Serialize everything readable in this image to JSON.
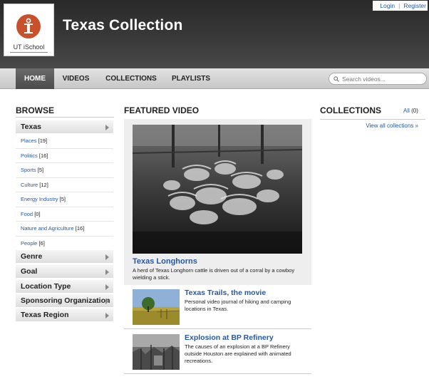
{
  "header": {
    "links": {
      "login": "Login",
      "separator": "|",
      "register": "Register"
    },
    "logo_text": "UT iSchool",
    "site_title": "Texas Collection"
  },
  "nav": {
    "items": [
      {
        "label": "HOME",
        "active": true
      },
      {
        "label": "VIDEOS"
      },
      {
        "label": "COLLECTIONS"
      },
      {
        "label": "PLAYLISTS"
      }
    ],
    "search_placeholder": "Search videos..."
  },
  "browse": {
    "heading": "BROWSE",
    "expanded_category": "Texas",
    "subitems": [
      {
        "label": "Places",
        "count": "[19]"
      },
      {
        "label": "Politics",
        "count": "[16]"
      },
      {
        "label": "Sports",
        "count": "[5]"
      },
      {
        "label": "Culture",
        "count": "[12]"
      },
      {
        "label": "Energy Industry",
        "count": "[5]"
      },
      {
        "label": "Food",
        "count": "[0]"
      },
      {
        "label": "Nature and Agriculture",
        "count": "[16]"
      },
      {
        "label": "People",
        "count": "[6]"
      }
    ],
    "categories": [
      "Genre",
      "Goal",
      "Location Type",
      "Sponsoring Organization",
      "Texas Region"
    ]
  },
  "featured": {
    "heading": "FEATURED VIDEO",
    "title": "Texas Longhorns",
    "description": "A herd of Texas Longhorn cattle is driven out of a corral by a cowboy wielding a stick."
  },
  "related": [
    {
      "title": "Texas Trails, the movie",
      "description": "Personal video journal of hiking and camping locations in Texas."
    },
    {
      "title": "Explosion at BP Refinery",
      "description": "The causes of an explosion at a BP Refinery outside Houston are explained with animated recreations."
    }
  ],
  "collections": {
    "heading": "COLLECTIONS",
    "all_label": "All",
    "all_count": "(0)",
    "view_all": "View all collections »"
  },
  "colors": {
    "link": "#2458a6",
    "logo": "#c8502b",
    "header": "#333333"
  }
}
